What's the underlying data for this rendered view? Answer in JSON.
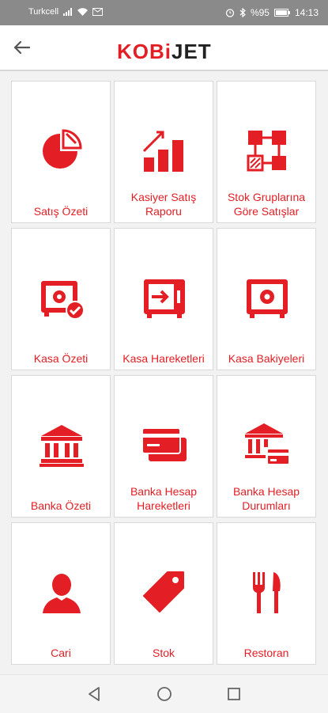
{
  "status_bar": {
    "carrier": "Turkcell",
    "battery": "%95",
    "time": "14:13"
  },
  "app_bar": {
    "logo": {
      "part1": "KOBi",
      "part2": "JET"
    }
  },
  "tiles": [
    {
      "label": "Satış Özeti",
      "icon": "pie-chart-icon"
    },
    {
      "label": "Kasiyer Satış Raporu",
      "icon": "bar-chart-icon"
    },
    {
      "label": "Stok Gruplarına Göre Satışlar",
      "icon": "network-grid-icon"
    },
    {
      "label": "Kasa Özeti",
      "icon": "safe-check-icon"
    },
    {
      "label": "Kasa Hareketleri",
      "icon": "safe-enter-icon"
    },
    {
      "label": "Kasa Bakiyeleri",
      "icon": "safe-icon"
    },
    {
      "label": "Banka Özeti",
      "icon": "bank-icon"
    },
    {
      "label": "Banka Hesap Hareketleri",
      "icon": "credit-cards-icon"
    },
    {
      "label": "Banka Hesap Durumları",
      "icon": "bank-card-icon"
    },
    {
      "label": "Cari",
      "icon": "person-icon"
    },
    {
      "label": "Stok",
      "icon": "tag-icon"
    },
    {
      "label": "Restoran",
      "icon": "fork-knife-icon"
    }
  ],
  "colors": {
    "brand": "#e31e24",
    "tile_border": "#d9d9d9",
    "background": "#f2f2f2"
  }
}
